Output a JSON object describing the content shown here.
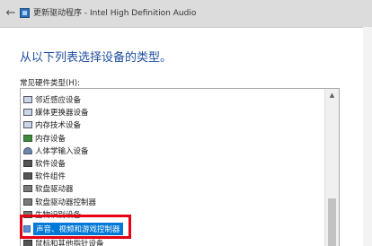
{
  "window": {
    "title": "更新驱动程序 - Intel High Definition Audio",
    "back_icon": "arrow-left-icon",
    "app_icon": "device-manager-icon"
  },
  "main": {
    "heading": "从以下列表选择设备的类型。",
    "list_label": "常见硬件类型(H):"
  },
  "hardware_types": [
    {
      "label": "邻近感应设备",
      "icon": "proximity-icon"
    },
    {
      "label": "媒体更换器设备",
      "icon": "media-changer-icon"
    },
    {
      "label": "内存技术设备",
      "icon": "memory-tech-icon"
    },
    {
      "label": "内存设备",
      "icon": "memory-icon"
    },
    {
      "label": "人体学输入设备",
      "icon": "hid-icon"
    },
    {
      "label": "软件设备",
      "icon": "software-device-icon"
    },
    {
      "label": "软件组件",
      "icon": "software-component-icon"
    },
    {
      "label": "软盘驱动器",
      "icon": "floppy-drive-icon"
    },
    {
      "label": "软盘驱动器控制器",
      "icon": "floppy-controller-icon"
    },
    {
      "label": "生物识别设备",
      "icon": "biometric-icon"
    },
    {
      "label": "声音、视频和游戏控制器",
      "icon": "speaker-icon",
      "selected": true
    },
    {
      "label": "鼠标和其他指针设备",
      "icon": "mouse-icon"
    }
  ],
  "colors": {
    "heading": "#1f4fa0",
    "selection": "#0078d7",
    "annotation_box": "#e60012"
  }
}
